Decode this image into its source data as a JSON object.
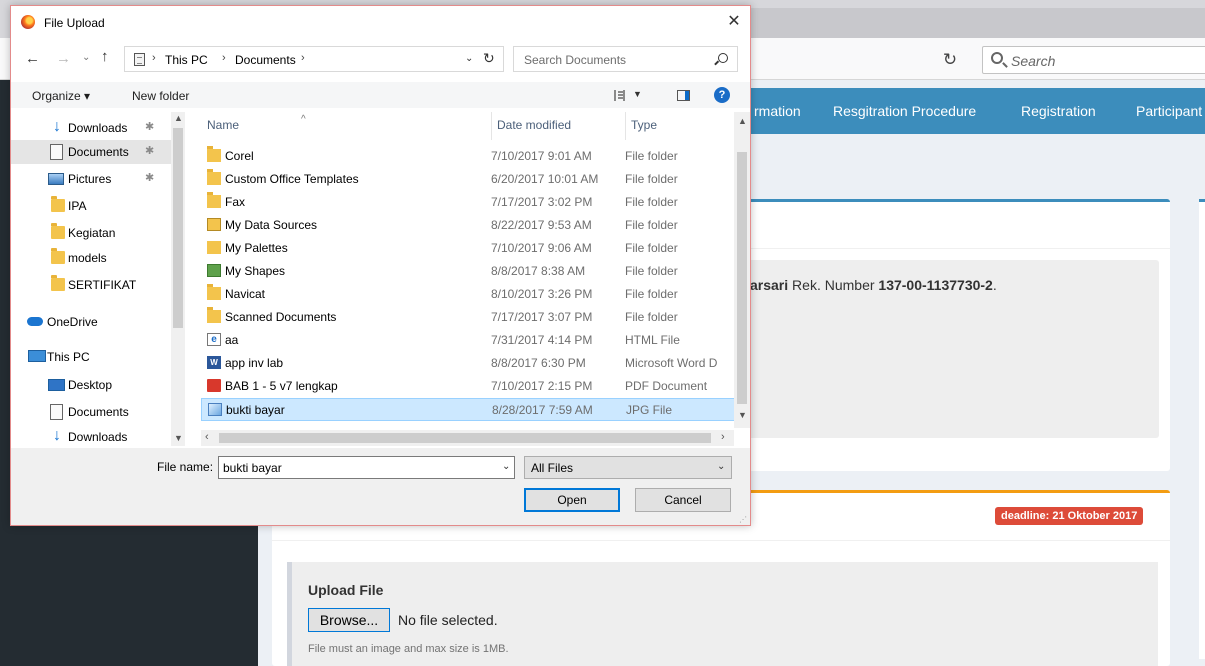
{
  "browser": {
    "search_placeholder": "Search",
    "reload_icon": "reload-icon"
  },
  "site": {
    "nav": [
      "rmation",
      "Resgitration Procedure",
      "Registration",
      "Participant"
    ],
    "bank_name_fragment": "arsari",
    "bank_text": " Rek. Number ",
    "bank_account": "137-00-1137730-2",
    "bank_tail": ".",
    "deadline": "deadline: 21 Oktober 2017",
    "upload_title": "Upload File",
    "browse_label": "Browse...",
    "no_file": "No file selected.",
    "help": "File must an image and max size is 1MB.",
    "colors": {
      "nav": "#3c8dbc",
      "accent_orange": "#f39c12",
      "deadline_red": "#dd4b39",
      "sidebar": "#242c32"
    }
  },
  "dialog": {
    "title": "File Upload",
    "close": "✕",
    "path": {
      "segment1": "This PC",
      "segment2": "Documents",
      "sep": "›"
    },
    "search_placeholder": "Search Documents",
    "toolbar": {
      "organize": "Organize ▾",
      "new_folder": "New folder",
      "help": "?"
    },
    "nav_items": [
      {
        "label": "Downloads",
        "icon": "downloads-icon",
        "pinned": true
      },
      {
        "label": "Documents",
        "icon": "documents-icon",
        "pinned": true,
        "selected": true
      },
      {
        "label": "Pictures",
        "icon": "pictures-icon",
        "pinned": true
      },
      {
        "label": "IPA",
        "icon": "folder-icon"
      },
      {
        "label": "Kegiatan",
        "icon": "folder-icon"
      },
      {
        "label": "models",
        "icon": "folder-icon"
      },
      {
        "label": "SERTIFIKAT",
        "icon": "folder-icon"
      },
      {
        "label": "OneDrive",
        "icon": "onedrive-icon"
      },
      {
        "label": "This PC",
        "icon": "this-pc-icon"
      },
      {
        "label": "Desktop",
        "icon": "desktop-icon"
      },
      {
        "label": "Documents",
        "icon": "documents-icon"
      },
      {
        "label": "Downloads",
        "icon": "downloads-icon"
      }
    ],
    "columns": [
      "Name",
      "Date modified",
      "Type"
    ],
    "files": [
      {
        "name": "Corel",
        "date": "7/10/2017 9:01 AM",
        "type": "File folder",
        "icon": "folder"
      },
      {
        "name": "Custom Office Templates",
        "date": "6/20/2017 10:01 AM",
        "type": "File folder",
        "icon": "folder"
      },
      {
        "name": "Fax",
        "date": "7/17/2017 3:02 PM",
        "type": "File folder",
        "icon": "folder"
      },
      {
        "name": "My Data Sources",
        "date": "8/22/2017 9:53 AM",
        "type": "File folder",
        "icon": "datasrc"
      },
      {
        "name": "My Palettes",
        "date": "7/10/2017 9:06 AM",
        "type": "File folder",
        "icon": "pal"
      },
      {
        "name": "My Shapes",
        "date": "8/8/2017 8:38 AM",
        "type": "File folder",
        "icon": "shapes"
      },
      {
        "name": "Navicat",
        "date": "8/10/2017 3:26 PM",
        "type": "File folder",
        "icon": "folder"
      },
      {
        "name": "Scanned Documents",
        "date": "7/17/2017 3:07 PM",
        "type": "File folder",
        "icon": "folder"
      },
      {
        "name": "aa",
        "date": "7/31/2017 4:14 PM",
        "type": "HTML File",
        "icon": "html"
      },
      {
        "name": "app inv lab",
        "date": "8/8/2017 6:30 PM",
        "type": "Microsoft Word D",
        "icon": "word"
      },
      {
        "name": "BAB 1 - 5 v7 lengkap",
        "date": "7/10/2017 2:15 PM",
        "type": "PDF Document",
        "icon": "pdf"
      },
      {
        "name": "bukti bayar",
        "date": "8/28/2017 7:59 AM",
        "type": "JPG File",
        "icon": "jpg",
        "selected": true
      }
    ],
    "file_name_label": "File name:",
    "file_name_value": "bukti bayar",
    "file_type": "All Files",
    "open_label": "Open",
    "cancel_label": "Cancel"
  }
}
